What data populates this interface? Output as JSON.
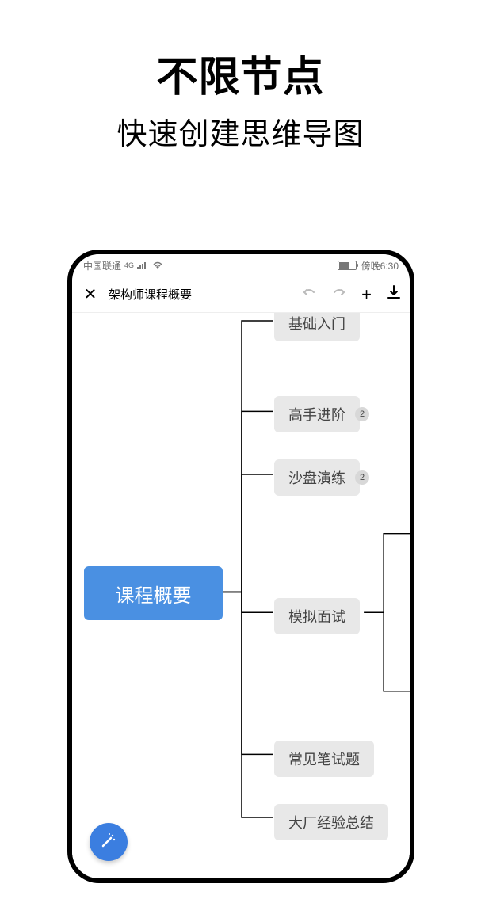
{
  "promo": {
    "title": "不限节点",
    "subtitle": "快速创建思维导图"
  },
  "status": {
    "carrier": "中国联通",
    "network": "4G",
    "time": "傍晚6:30"
  },
  "toolbar": {
    "doc_title": "架构师课程概要"
  },
  "mindmap": {
    "root": "课程概要",
    "children": [
      {
        "label": "基础入门",
        "badge": null
      },
      {
        "label": "高手进阶",
        "badge": "2"
      },
      {
        "label": "沙盘演练",
        "badge": "2"
      },
      {
        "label": "模拟面试",
        "badge": null
      },
      {
        "label": "常见笔试题",
        "badge": null
      },
      {
        "label": "大厂经验总结",
        "badge": null
      }
    ]
  }
}
